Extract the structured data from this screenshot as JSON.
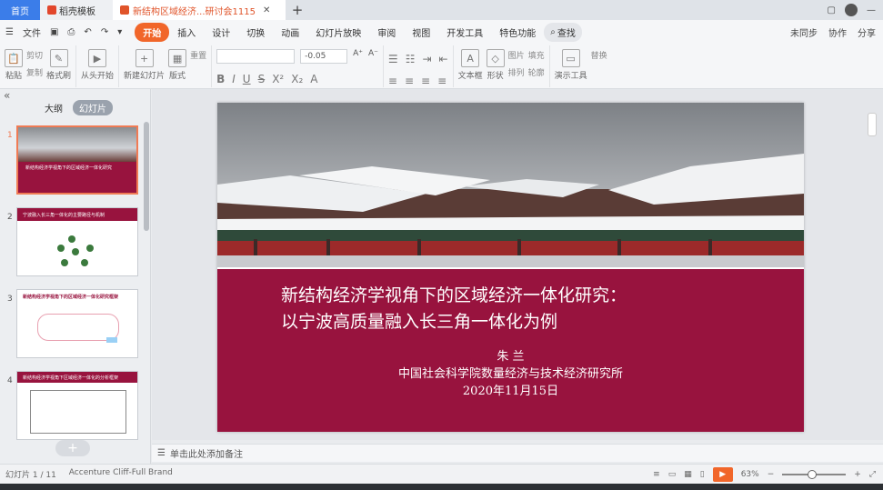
{
  "tabs": {
    "home": "首页",
    "templates": "稻壳模板",
    "document": "新结构区域经济...研讨会1115"
  },
  "menu": {
    "file": "文件",
    "tabs": [
      "开始",
      "插入",
      "设计",
      "切换",
      "动画",
      "幻灯片放映",
      "审阅",
      "视图",
      "开发工具",
      "特色功能"
    ],
    "search": "查找",
    "right": [
      "未同步",
      "协作",
      "分享"
    ]
  },
  "ribbon": {
    "paste": "粘贴",
    "cut": "剪切",
    "copy": "复制",
    "format_painter": "格式刷",
    "from_start": "从头开始",
    "new_slide": "新建幻灯片",
    "layout": "版式",
    "reset": "重置",
    "font_size": "-0.05",
    "textbox": "文本框",
    "shape": "形状",
    "picture": "图片",
    "fill": "填充",
    "arrange": "排列",
    "outline": "轮廓",
    "present_tools": "演示工具",
    "replace": "替换"
  },
  "panel": {
    "outline_tab": "大纲",
    "slides_tab": "幻灯片"
  },
  "thumbnails": [
    {
      "num": "1",
      "text": "新结构经济学视角下的区域经济一体化研究"
    },
    {
      "num": "2",
      "text": "宁波融入长三角一体化的主要路径与机制"
    },
    {
      "num": "3",
      "text": "新结构经济学视角下的区域经济一体化研究框架"
    },
    {
      "num": "4",
      "text": "新结构经济学视角下区域经济一体化的分析框架"
    }
  ],
  "slide": {
    "title_line1": "新结构经济学视角下的区域经济一体化研究：",
    "title_line2": "以宁波高质量融入长三角一体化为例",
    "author": "朱 兰",
    "institution": "中国社会科学院数量经济与技术经济研究所",
    "date": "2020年11月15日"
  },
  "notes": "单击此处添加备注",
  "status": {
    "slide_count": "幻灯片 1 / 11",
    "theme": "Accenture Cliff-Full Brand",
    "zoom": "63%"
  },
  "colors": {
    "accent": "#f1662a",
    "slide_red": "#98133e",
    "tab_blue": "#3b7de9"
  }
}
